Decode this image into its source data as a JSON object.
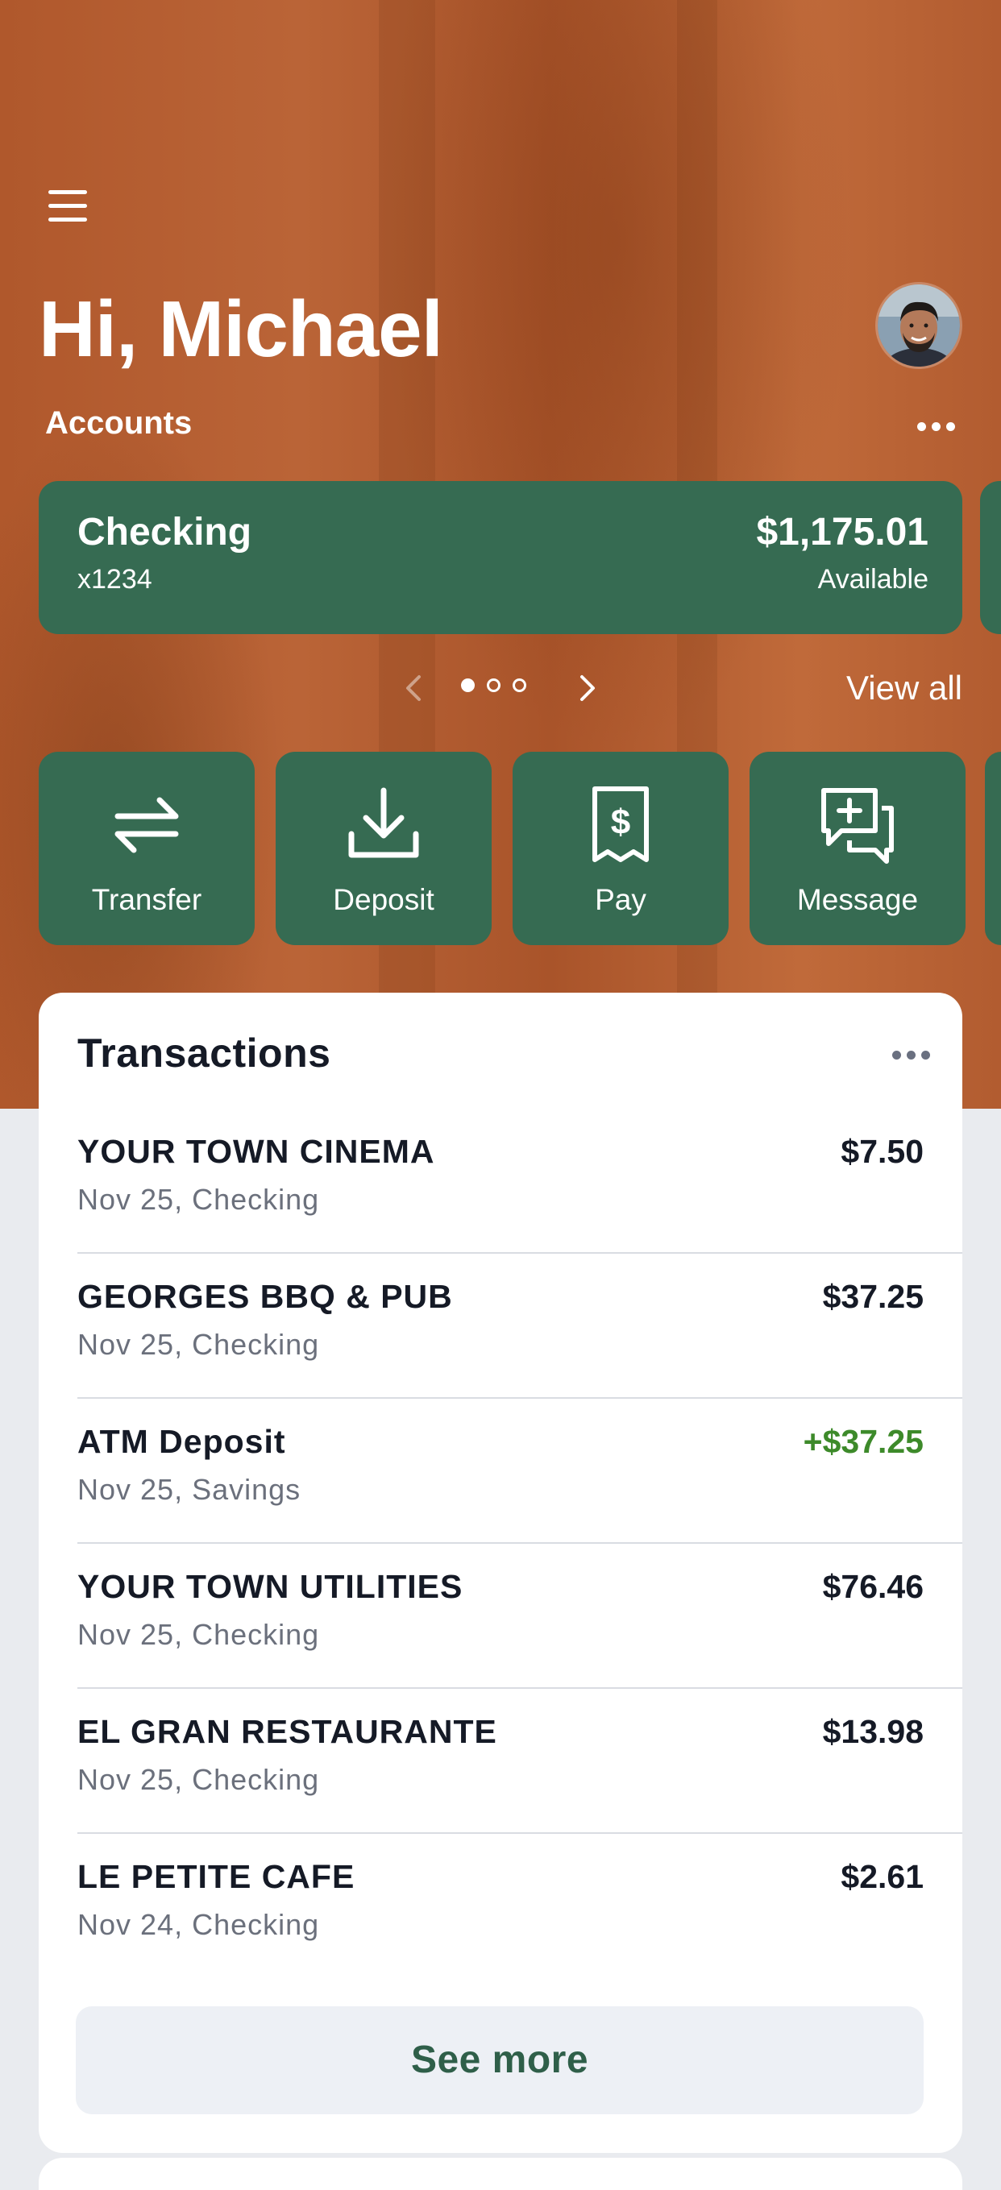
{
  "header": {
    "greeting": "Hi, Michael",
    "menu_icon": "hamburger-menu-icon",
    "avatar_icon": "user-avatar"
  },
  "accounts": {
    "label": "Accounts",
    "more_icon": "more-dots-icon",
    "current": {
      "name": "Checking",
      "number": "x1234",
      "balance": "$1,175.01",
      "balance_label": "Available"
    },
    "pager": {
      "page": 1,
      "total": 3
    },
    "view_all": "View all"
  },
  "actions": [
    {
      "label": "Transfer",
      "icon": "transfer-arrows-icon"
    },
    {
      "label": "Deposit",
      "icon": "download-deposit-icon"
    },
    {
      "label": "Pay",
      "icon": "bill-receipt-icon"
    },
    {
      "label": "Message",
      "icon": "message-add-icon"
    }
  ],
  "transactions": {
    "title": "Transactions",
    "items": [
      {
        "name": "YOUR TOWN CINEMA",
        "sub": "Nov 25, Checking",
        "amount": "$7.50"
      },
      {
        "name": "GEORGES BBQ & PUB",
        "sub": "Nov 25, Checking",
        "amount": "$37.25"
      },
      {
        "name": "ATM Deposit",
        "sub": "Nov 25, Savings",
        "amount": "+$37.25"
      },
      {
        "name": "YOUR TOWN UTILITIES",
        "sub": "Nov 25, Checking",
        "amount": "$76.46"
      },
      {
        "name": "EL GRAN RESTAURANTE",
        "sub": "Nov 25, Checking",
        "amount": "$13.98"
      },
      {
        "name": "LE PETITE CAFE",
        "sub": "Nov 24, Checking",
        "amount": "$2.61"
      }
    ],
    "see_more": "See more"
  },
  "colors": {
    "hero": "#b25c30",
    "card_green": "#366b52",
    "credit_green": "#3d8a2a",
    "see_more_text": "#2f5f49"
  }
}
